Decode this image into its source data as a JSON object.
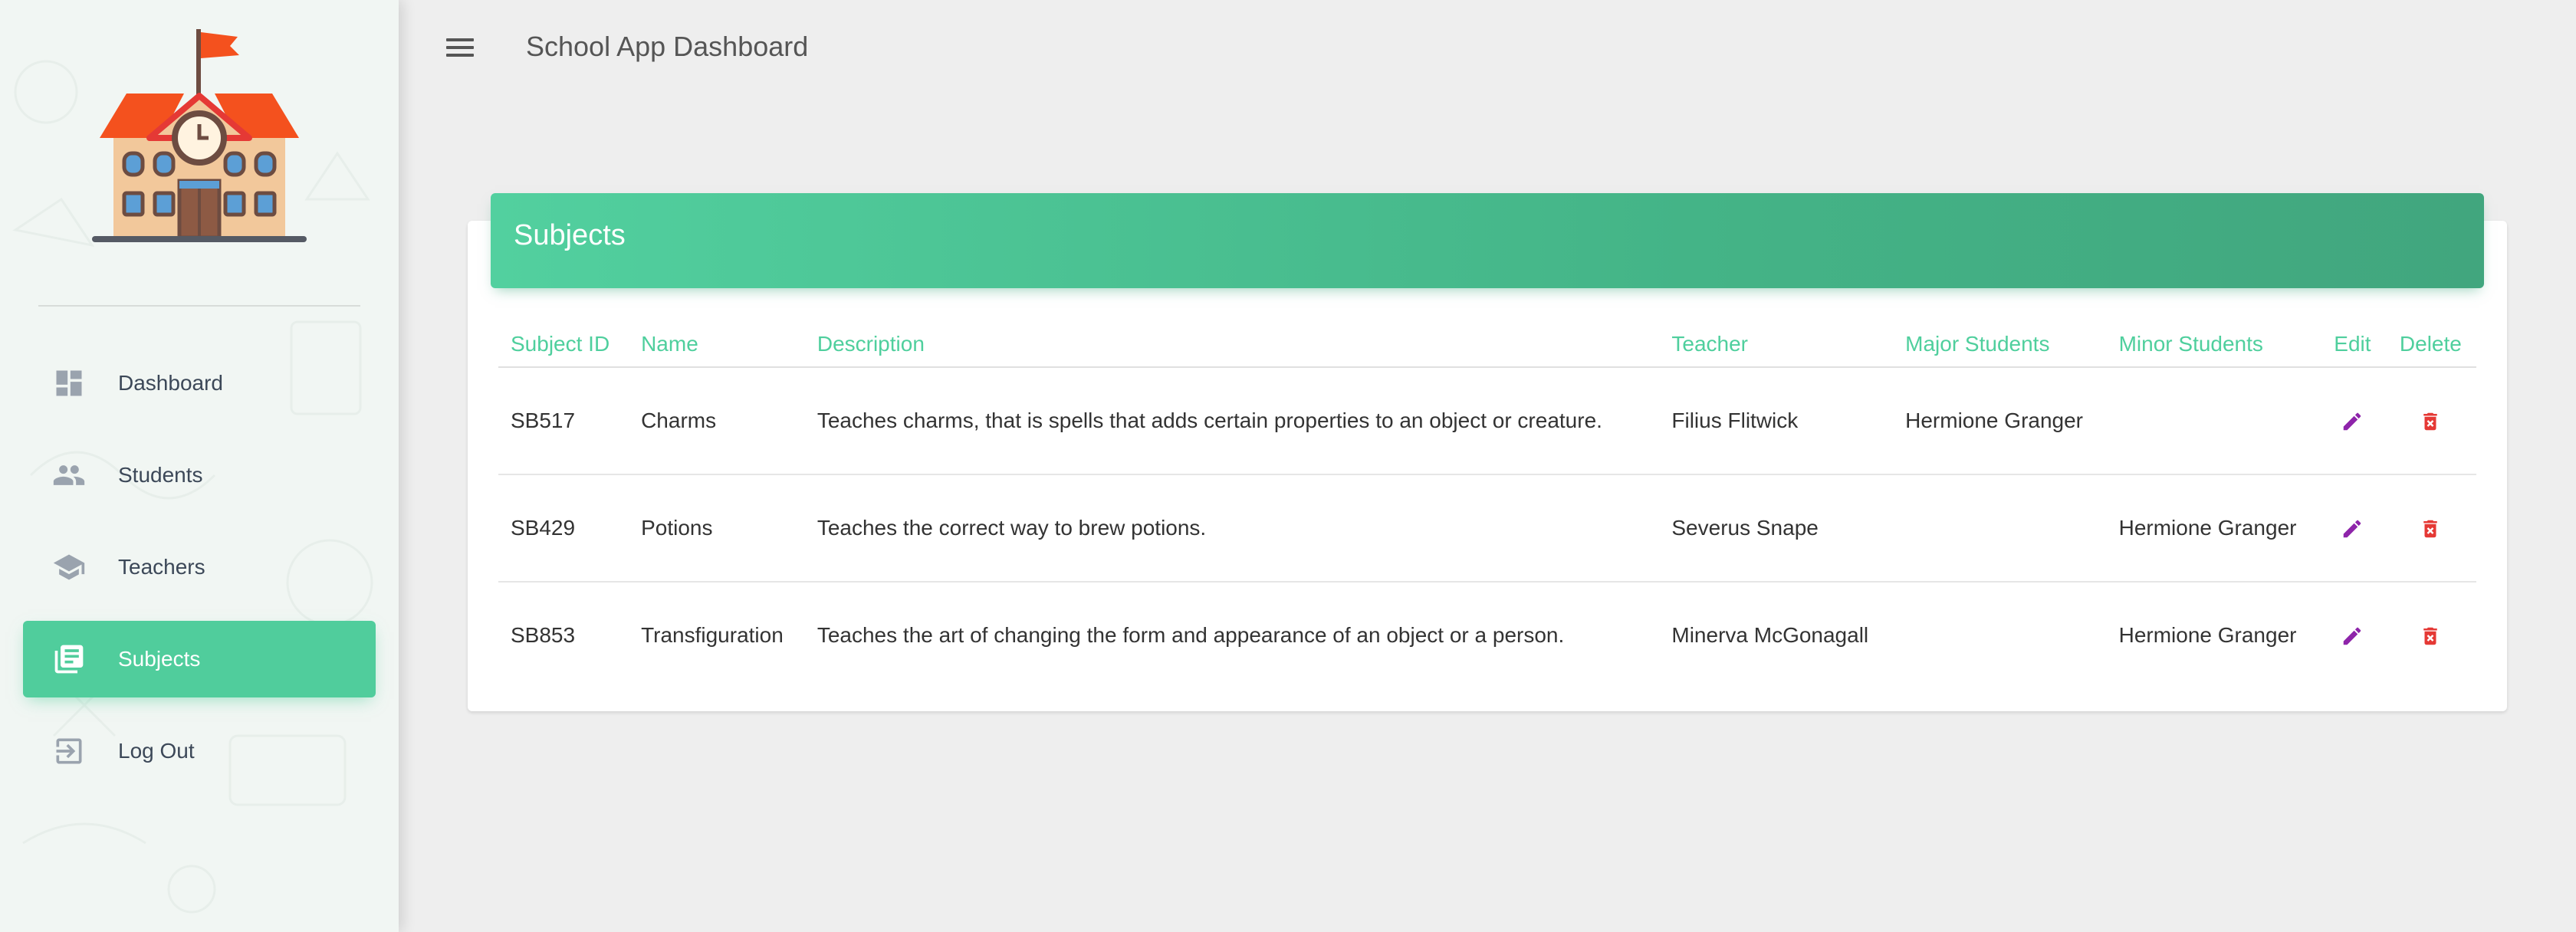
{
  "header": {
    "title": "School App Dashboard"
  },
  "sidebar": {
    "items": [
      {
        "label": "Dashboard",
        "icon": "dashboard-icon",
        "active": false
      },
      {
        "label": "Students",
        "icon": "people-icon",
        "active": false
      },
      {
        "label": "Teachers",
        "icon": "school-cap-icon",
        "active": false
      },
      {
        "label": "Subjects",
        "icon": "library-books-icon",
        "active": true
      },
      {
        "label": "Log Out",
        "icon": "exit-icon",
        "active": false
      }
    ]
  },
  "card": {
    "title": "Subjects",
    "columns": [
      "Subject ID",
      "Name",
      "Description",
      "Teacher",
      "Major Students",
      "Minor Students",
      "Edit",
      "Delete"
    ],
    "rows": [
      {
        "id": "SB517",
        "name": "Charms",
        "description": "Teaches charms, that is spells that adds certain properties to an object or creature.",
        "teacher": "Filius Flitwick",
        "major": "Hermione Granger",
        "minor": ""
      },
      {
        "id": "SB429",
        "name": "Potions",
        "description": "Teaches the correct way to brew potions.",
        "teacher": "Severus Snape",
        "major": "",
        "minor": "Hermione Granger"
      },
      {
        "id": "SB853",
        "name": "Transfiguration",
        "description": "Teaches the art of changing the form and appearance of an object or a person.",
        "teacher": "Minerva McGonagall",
        "major": "",
        "minor": "Hermione Granger"
      }
    ]
  },
  "colors": {
    "accent": "#50cd9c",
    "edit": "#8e24aa",
    "delete": "#e53935"
  }
}
